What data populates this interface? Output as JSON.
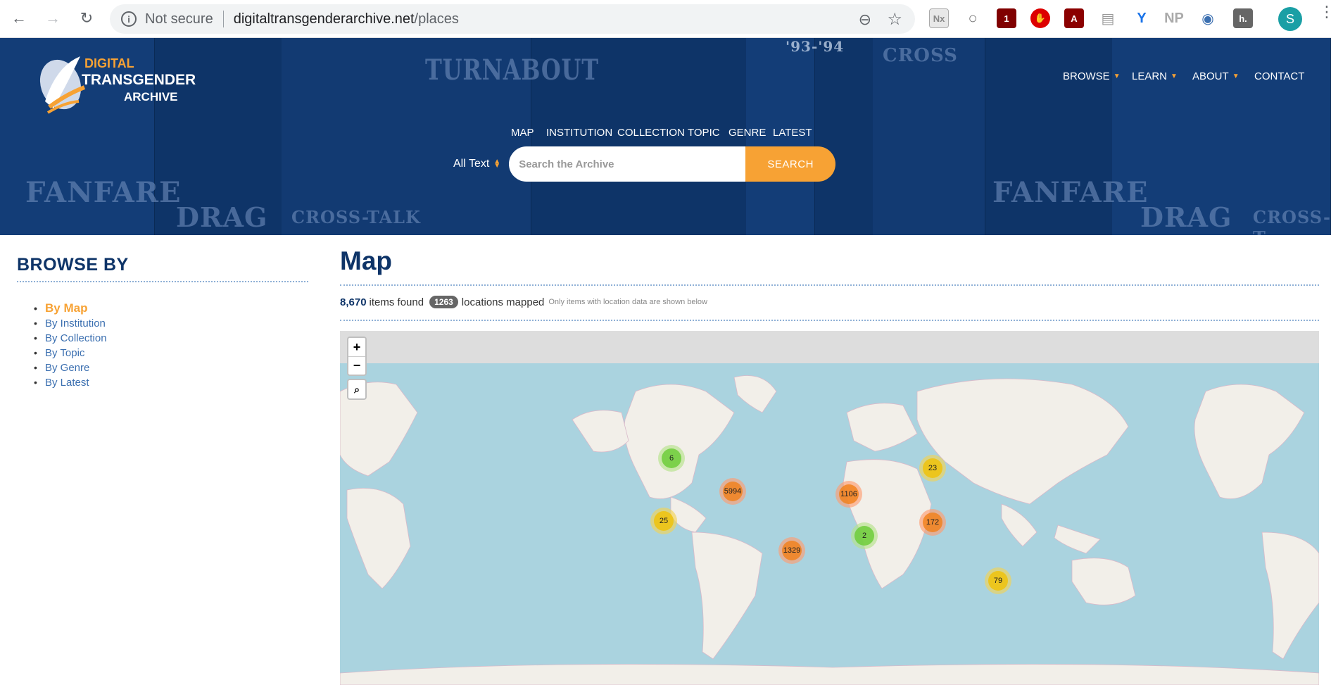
{
  "browser": {
    "not_secure": "Not secure",
    "url_host": "digitaltransgenderarchive.net",
    "url_path": "/places",
    "extensions": [
      "Nx",
      "○",
      "1",
      "✋",
      "A",
      "▤",
      "NP",
      "◉",
      "h."
    ],
    "profile_initial": "S"
  },
  "site": {
    "logo": {
      "line1": "DIGITAL",
      "line2": "TRANSGENDER",
      "line3": "ARCHIVE"
    },
    "topnav": {
      "browse": "BROWSE",
      "learn": "LEARN",
      "about": "ABOUT",
      "contact": "CONTACT"
    },
    "subnav": {
      "map": "MAP",
      "institution": "INSTITUTION",
      "collection": "COLLECTION",
      "topic": "TOPIC",
      "genre": "GENRE",
      "latest": "LATEST"
    },
    "search": {
      "scope": "All Text",
      "placeholder": "Search the Archive",
      "button": "SEARCH"
    },
    "hero_words": [
      "FANFARE",
      "DRAG",
      "CROSS-TALK",
      "TURNABOUT",
      "'93-'94",
      "CROSS",
      "FANFARE",
      "DRAG",
      "CROSS-T"
    ]
  },
  "sidebar": {
    "title": "BROWSE BY",
    "items": [
      {
        "label": "By Map",
        "active": true
      },
      {
        "label": "By Institution"
      },
      {
        "label": "By Collection"
      },
      {
        "label": "By Topic"
      },
      {
        "label": "By Genre"
      },
      {
        "label": "By Latest"
      }
    ]
  },
  "main": {
    "title": "Map",
    "items_count": "8,670",
    "items_label": "items found",
    "locations_count": "1263",
    "locations_label": "locations mapped",
    "note": "Only items with location data are shown below"
  },
  "map": {
    "zoom_in": "+",
    "zoom_out": "−",
    "clusters": [
      {
        "label": "6",
        "size": "small"
      },
      {
        "label": "5994",
        "size": "large"
      },
      {
        "label": "25",
        "size": "med"
      },
      {
        "label": "1329",
        "size": "large"
      },
      {
        "label": "1106",
        "size": "large"
      },
      {
        "label": "2",
        "size": "small"
      },
      {
        "label": "23",
        "size": "med"
      },
      {
        "label": "172",
        "size": "large"
      },
      {
        "label": "79",
        "size": "med"
      }
    ]
  },
  "colors": {
    "navy": "#0e3468",
    "orange": "#f7a234",
    "ocean": "#aad3df",
    "land": "#f2efe9"
  }
}
